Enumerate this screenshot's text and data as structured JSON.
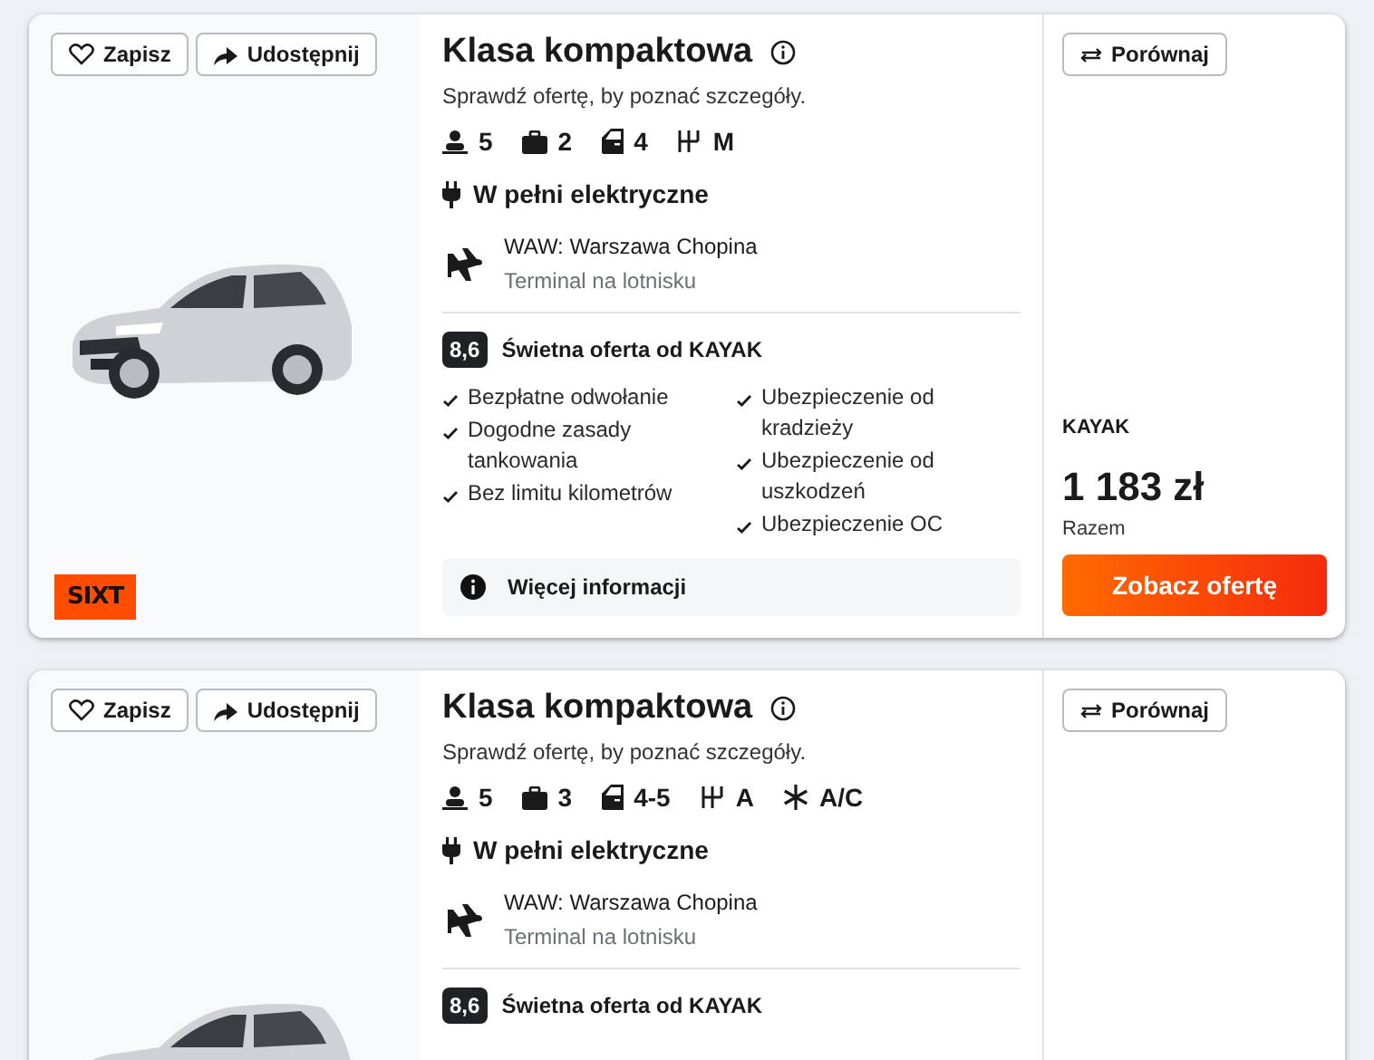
{
  "offers": [
    {
      "save": "Zapisz",
      "share": "Udostępnij",
      "title": "Klasa kompaktowa",
      "subtitle": "Sprawdź ofertę, by poznać szczegóły.",
      "features": [
        {
          "kind": "seats",
          "text": "5"
        },
        {
          "kind": "bags",
          "text": "2"
        },
        {
          "kind": "doors",
          "text": "4"
        },
        {
          "kind": "transmission",
          "text": "M"
        }
      ],
      "fuel": "W pełni elektryczne",
      "location": {
        "name": "WAW: Warszawa Chopina",
        "type": "Terminal na lotnisku"
      },
      "rating": {
        "score": "8,6",
        "label": "Świetna oferta od KAYAK"
      },
      "benefits_left": [
        "Bezpłatne odwołanie",
        "Dogodne zasady tankowania",
        "Bez limitu kilometrów"
      ],
      "benefits_right": [
        "Ubezpieczenie od kradzieży",
        "Ubezpieczenie od uszkodzeń",
        "Ubezpieczenie OC"
      ],
      "more_info": "Więcej informacji",
      "compare": "Porównaj",
      "provider": "KAYAK",
      "price": "1 183 zł",
      "price_note": "Razem",
      "cta": "Zobacz ofertę",
      "supplier_logo": "SIXT"
    },
    {
      "save": "Zapisz",
      "share": "Udostępnij",
      "title": "Klasa kompaktowa",
      "subtitle": "Sprawdź ofertę, by poznać szczegóły.",
      "features": [
        {
          "kind": "seats",
          "text": "5"
        },
        {
          "kind": "bags",
          "text": "3"
        },
        {
          "kind": "doors",
          "text": "4-5"
        },
        {
          "kind": "transmission",
          "text": "A"
        },
        {
          "kind": "ac",
          "text": "A/C"
        }
      ],
      "fuel": "W pełni elektryczne",
      "location": {
        "name": "WAW: Warszawa Chopina",
        "type": "Terminal na lotnisku"
      },
      "rating": {
        "score": "8,6",
        "label": "Świetna oferta od KAYAK"
      },
      "compare": "Porównaj"
    }
  ]
}
